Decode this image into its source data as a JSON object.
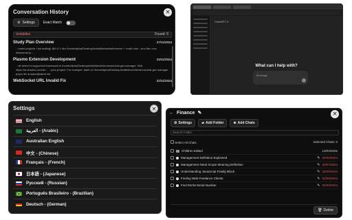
{
  "history": {
    "title": "Conversation History",
    "settings_label": "Settings",
    "exact_match_label": "Exact Match",
    "search_value": "/extablies",
    "found_text": "Found: 5",
    "items": [
      {
        "title": "Study Plan Overview",
        "date": "27/11/2024",
        "snippet": "...main\\ projects \\ bot adding\\ @0.0.1 dev /home/alpha/Desktop/extablies/website/server + node-mon --env-file=.env dist/server.js ..."
      },
      {
        "title": "Plasmo Extension Development",
        "date": "23/11/2024",
        "snippet": "...dir detect a supported framework.in /home/alpha/Desktop/extablies/extensions/chat-get-manager. Visit https://ui.shadcn.com/do... ...your project. For example: bash cd /home/alpha/Desktop/extablies/extensions/chat-get-manager pnpm dlx shadcn@latest init"
      },
      {
        "title": "WebSocket URL Invalid Fix",
        "date": "22/11/2024",
        "snippet": ""
      }
    ]
  },
  "browser": {
    "model_label": "ChatGPT ∨",
    "help_text": "What can I help with?",
    "message_placeholder": "Message"
  },
  "settings": {
    "title": "Settings",
    "languages": [
      {
        "label": "English",
        "flag": "us"
      },
      {
        "label": "العربية - (Arabic)",
        "flag": "sa"
      },
      {
        "label": "Australian English",
        "flag": "au"
      },
      {
        "label": "中文 - (Chinese)",
        "flag": "cn"
      },
      {
        "label": "Français - (French)",
        "flag": "fr"
      },
      {
        "label": "日本語 - (Japanese)",
        "flag": "jp"
      },
      {
        "label": "Русский - (Russian)",
        "flag": "ru"
      },
      {
        "label": "Português Brasileiro - (Brazilian)",
        "flag": "br"
      },
      {
        "label": "Deutsch - (German)",
        "flag": "de"
      }
    ]
  },
  "folder": {
    "title": "Finance",
    "settings_label": "Settings",
    "add_folder_label": "Add Folder",
    "add_chats_label": "Add Chats",
    "search_placeholder": "Search Folder",
    "select_all_label": "Select All Chats",
    "selected_label": "Selected Chats: 0",
    "rows": [
      {
        "name": "Children Edited",
        "date": "13/03/2025",
        "kind": "folder",
        "due": false
      },
      {
        "name": "Management Definition Explained",
        "date": "24/03/2024",
        "kind": "chat",
        "due": true
      },
      {
        "name": "Management Need Scope Meaning Definition",
        "date": "20/07/2024",
        "kind": "chat",
        "due": true
      },
      {
        "name": "Understanding JavaScript Finally Block",
        "date": "02/09/2024",
        "kind": "chat",
        "due": true
      },
      {
        "name": "Finding Web Freelance Clients",
        "date": "02/09/2024",
        "kind": "chat",
        "due": true
      },
      {
        "name": "Find IMAM Serial Number",
        "date": "02/09/2024",
        "kind": "chat",
        "due": true
      }
    ],
    "delete_label": "Delete"
  }
}
